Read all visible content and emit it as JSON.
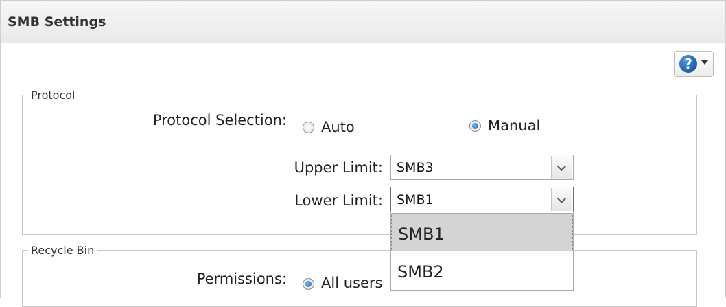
{
  "window": {
    "title": "SMB Settings"
  },
  "help": {
    "icon": "help-icon",
    "label": "?"
  },
  "protocol": {
    "legend": "Protocol",
    "selection_label": "Protocol Selection:",
    "options": [
      {
        "label": "Auto",
        "selected": false
      },
      {
        "label": "Manual",
        "selected": true
      }
    ],
    "upper_limit": {
      "label": "Upper Limit:",
      "value": "SMB3"
    },
    "lower_limit": {
      "label": "Lower Limit:",
      "value": "SMB1",
      "open": true,
      "options": [
        "SMB1",
        "SMB2"
      ],
      "highlighted": "SMB1"
    }
  },
  "recycle_bin": {
    "legend": "Recycle Bin",
    "permissions_label": "Permissions:",
    "permissions_value": "All users",
    "permissions_selected": true
  }
}
